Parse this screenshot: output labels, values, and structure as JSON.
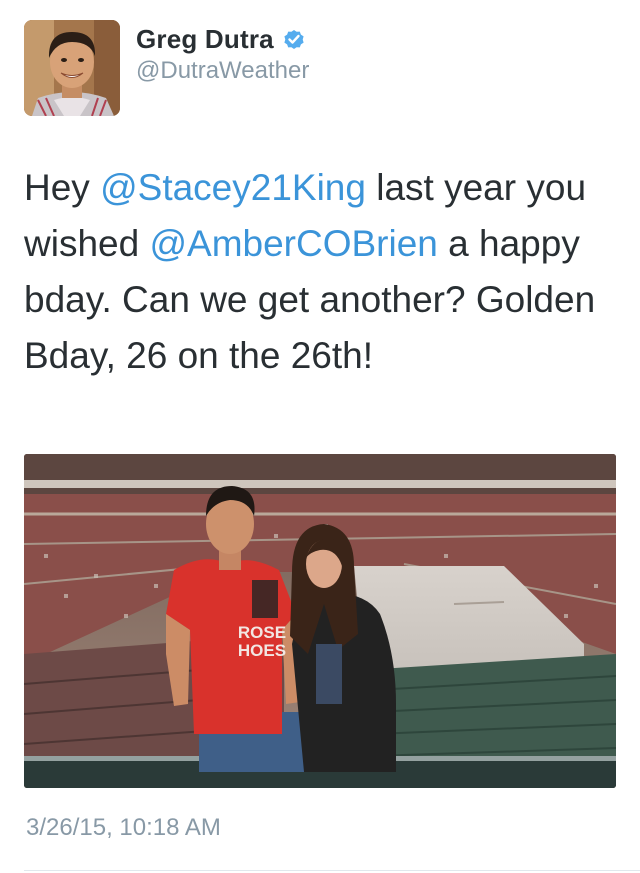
{
  "author": {
    "display_name": "Greg Dutra",
    "handle": "@DutraWeather",
    "verified": true,
    "verified_badge_color": "#55acee"
  },
  "tweet": {
    "segments": [
      {
        "text": "Hey ",
        "type": "text"
      },
      {
        "text": "@Stacey21King",
        "type": "mention"
      },
      {
        "text": " last year you wished ",
        "type": "text"
      },
      {
        "text": "@AmberCOBrien",
        "type": "mention"
      },
      {
        "text": " a happy bday. Can we get another? Golden Bday, 26 on the 26th!",
        "type": "text"
      }
    ],
    "mention_color": "#3b94d9",
    "timestamp": "3/26/15, 10:18 AM"
  },
  "media": {
    "type": "photo",
    "shirt_text_line1": "ROSE",
    "shirt_text_line2": "HOES"
  }
}
